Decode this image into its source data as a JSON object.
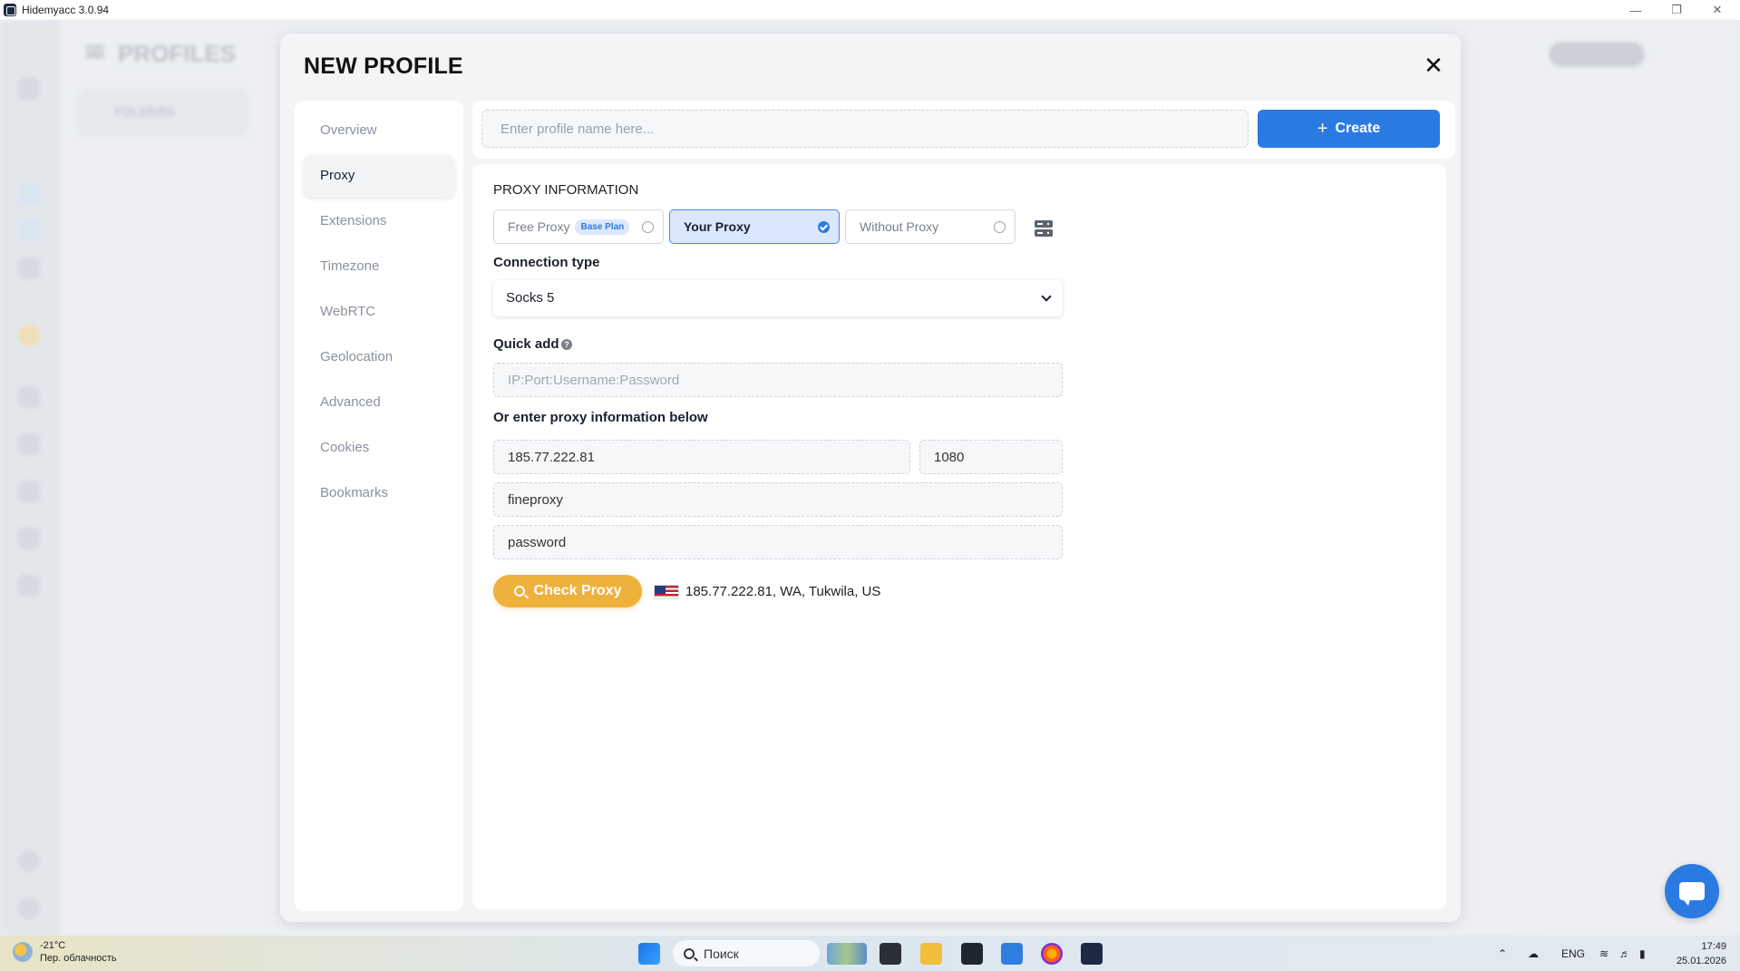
{
  "window": {
    "title": "Hidemyacc 3.0.94"
  },
  "background": {
    "page_title": "PROFILES",
    "folders_label": "FOLDERS"
  },
  "modal": {
    "title": "NEW PROFILE",
    "close_icon": "close-icon",
    "nav": [
      {
        "label": "Overview",
        "active": false
      },
      {
        "label": "Proxy",
        "active": true
      },
      {
        "label": "Extensions",
        "active": false
      },
      {
        "label": "Timezone",
        "active": false
      },
      {
        "label": "WebRTC",
        "active": false
      },
      {
        "label": "Geolocation",
        "active": false
      },
      {
        "label": "Advanced",
        "active": false
      },
      {
        "label": "Cookies",
        "active": false
      },
      {
        "label": "Bookmarks",
        "active": false
      }
    ],
    "profile_name": {
      "value": "",
      "placeholder": "Enter profile name here..."
    },
    "create_label": "Create"
  },
  "proxy": {
    "section_title": "PROXY INFORMATION",
    "options": [
      {
        "label": "Free Proxy",
        "badge": "Base Plan",
        "selected": false
      },
      {
        "label": "Your Proxy",
        "selected": true
      },
      {
        "label": "Without Proxy",
        "selected": false
      }
    ],
    "connection_type_label": "Connection type",
    "connection_type_value": "Socks 5",
    "quick_add_label": "Quick add",
    "quick_add": {
      "value": "",
      "placeholder": "IP:Port:Username:Password"
    },
    "manual_label": "Or enter proxy information below",
    "host": "185.77.222.81",
    "port": "1080",
    "username": "fineproxy",
    "password": "password",
    "check_label": "Check Proxy",
    "check_result": "185.77.222.81, WA, Tukwila, US"
  },
  "taskbar": {
    "weather_temp": "-21°C",
    "weather_desc": "Пер. облачность",
    "search_label": "Поиск",
    "language": "ENG",
    "time": "17:49",
    "date": "25.01.2026"
  },
  "colors": {
    "accent": "#2b7ae2",
    "check_button": "#f0b03c",
    "selected_option_bg": "#dbe7fb"
  }
}
